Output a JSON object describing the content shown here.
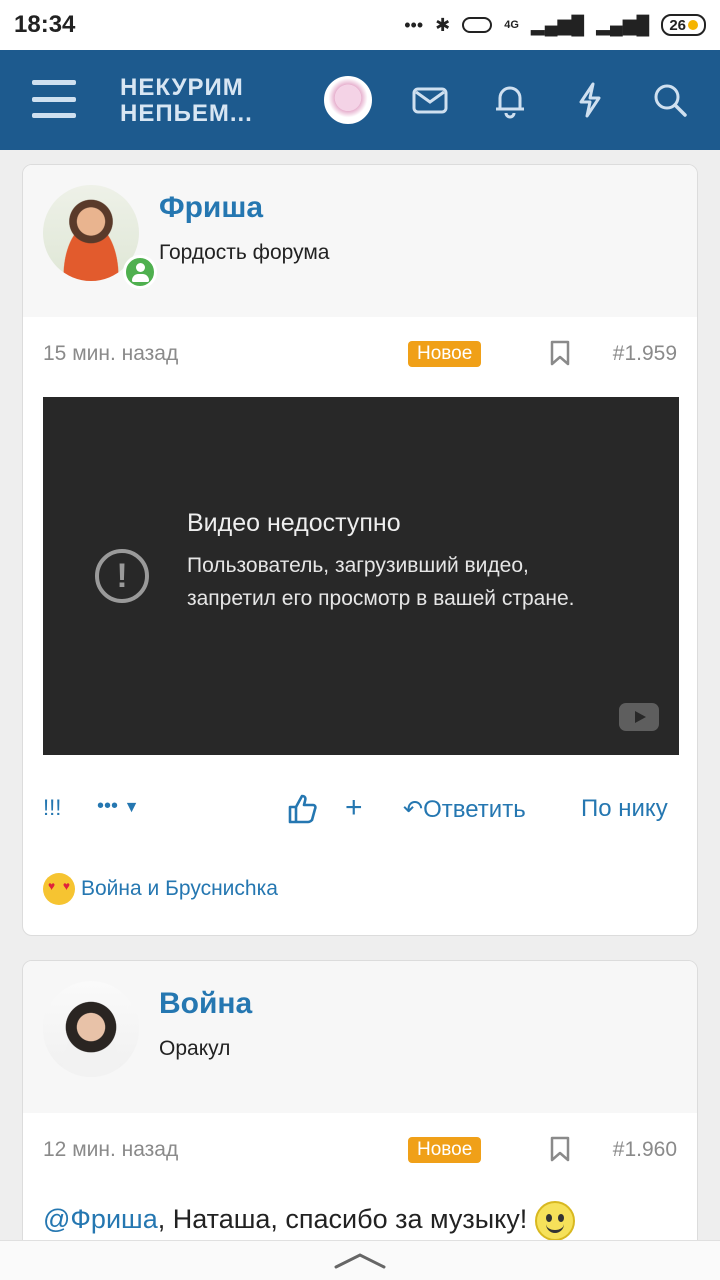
{
  "statusbar": {
    "time": "18:34",
    "dots": "•••",
    "network": "4G",
    "battery": "26"
  },
  "header": {
    "logo_line1": "НЕКУРИМ",
    "logo_line2": "НЕПЬЕМ..."
  },
  "posts": [
    {
      "author": "Фриша",
      "user_title": "Гордость форума",
      "time": "15 мин. назад",
      "badge": "Новое",
      "post_number": "#1.959",
      "video": {
        "title": "Видео недоступно",
        "message": "Пользователь, загрузивший видео, запретил его просмотр в вашей стране."
      },
      "actions": {
        "exclam": "!!!",
        "more": "•••",
        "plus": "+",
        "reply": "Ответить",
        "by_nick": "По нику"
      },
      "reactions": "Война и Брусниchка"
    },
    {
      "author": "Война",
      "user_title": "Оракул",
      "time": "12 мин. назад",
      "badge": "Новое",
      "post_number": "#1.960",
      "mention": "@Фриша",
      "text": ", Наташа, спасибо за музыку!"
    }
  ],
  "colors": {
    "header_bg": "#1d5a8e",
    "link": "#2577b1",
    "badge": "#f0a018",
    "video_bg": "#282828"
  }
}
